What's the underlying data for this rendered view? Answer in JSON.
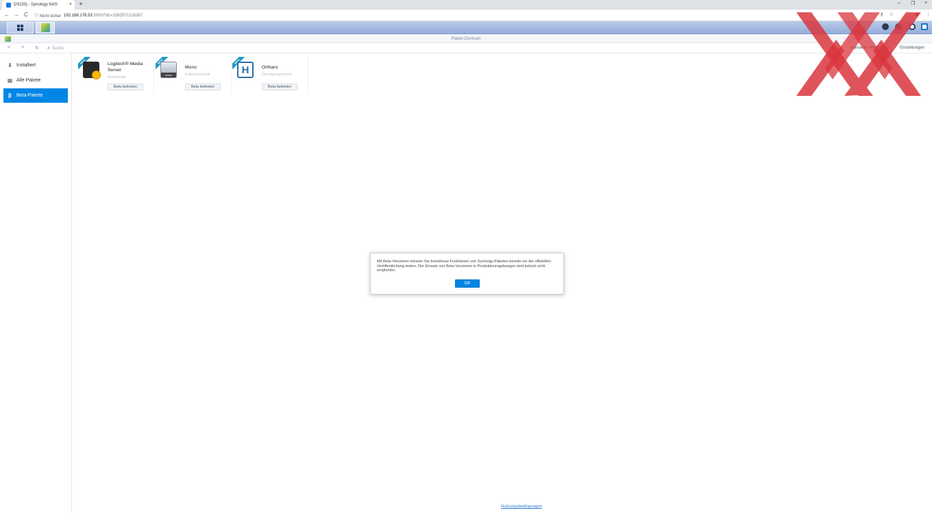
{
  "browser": {
    "tab_title": "DS220j - Synology NAS",
    "tab_close": "×",
    "new_tab": "+",
    "url_security": "ⓘ Nicht sicher",
    "url_host": "192.168.178.53",
    "url_rest": ":5000/?dc=1582571216267",
    "nav_back": "←",
    "nav_forward": "→",
    "nav_reload": "C",
    "window_minimize": "–",
    "window_restore": "❐",
    "window_close": "×"
  },
  "window": {
    "title": "Paket-Zentrum"
  },
  "toolbar": {
    "back": "<",
    "forward": ">",
    "refresh": "↻",
    "search_placeholder": "Suche",
    "manual_install": "Manuelle Installation",
    "settings": "Einstellungen"
  },
  "sidebar": {
    "items": [
      {
        "label": "Installiert",
        "icon": "installed-icon"
      },
      {
        "label": "Alle Pakete",
        "icon": "all-packages-icon"
      },
      {
        "label": "Beta-Pakete",
        "icon": "beta-icon",
        "active": true
      }
    ]
  },
  "packages": [
    {
      "name": "Logitech® Media Server",
      "category": "Multimedia",
      "button": "Beta beitreten",
      "ribbon": "BETA"
    },
    {
      "name": "Mono",
      "category": "Entwicklertools",
      "button": "Beta beitreten",
      "ribbon": "BETA"
    },
    {
      "name": "Orthanc",
      "category": "Dienstprogramme",
      "button": "Beta beitreten",
      "ribbon": "BETA"
    }
  ],
  "modal": {
    "text": "Mit Beta-Versionen können Sie brandneue Funktionen von Synology-Paketen bereits vor der offiziellen Veröffentlichung testen. Der Einsatz von Beta-Versionen in Produktivumgebungen wird jedoch nicht empfohlen.",
    "ok": "OK"
  },
  "footer": {
    "terms": "Nutzungsbedingungen"
  },
  "colors": {
    "accent": "#0086e5",
    "overlay_red": "#d9363e"
  }
}
